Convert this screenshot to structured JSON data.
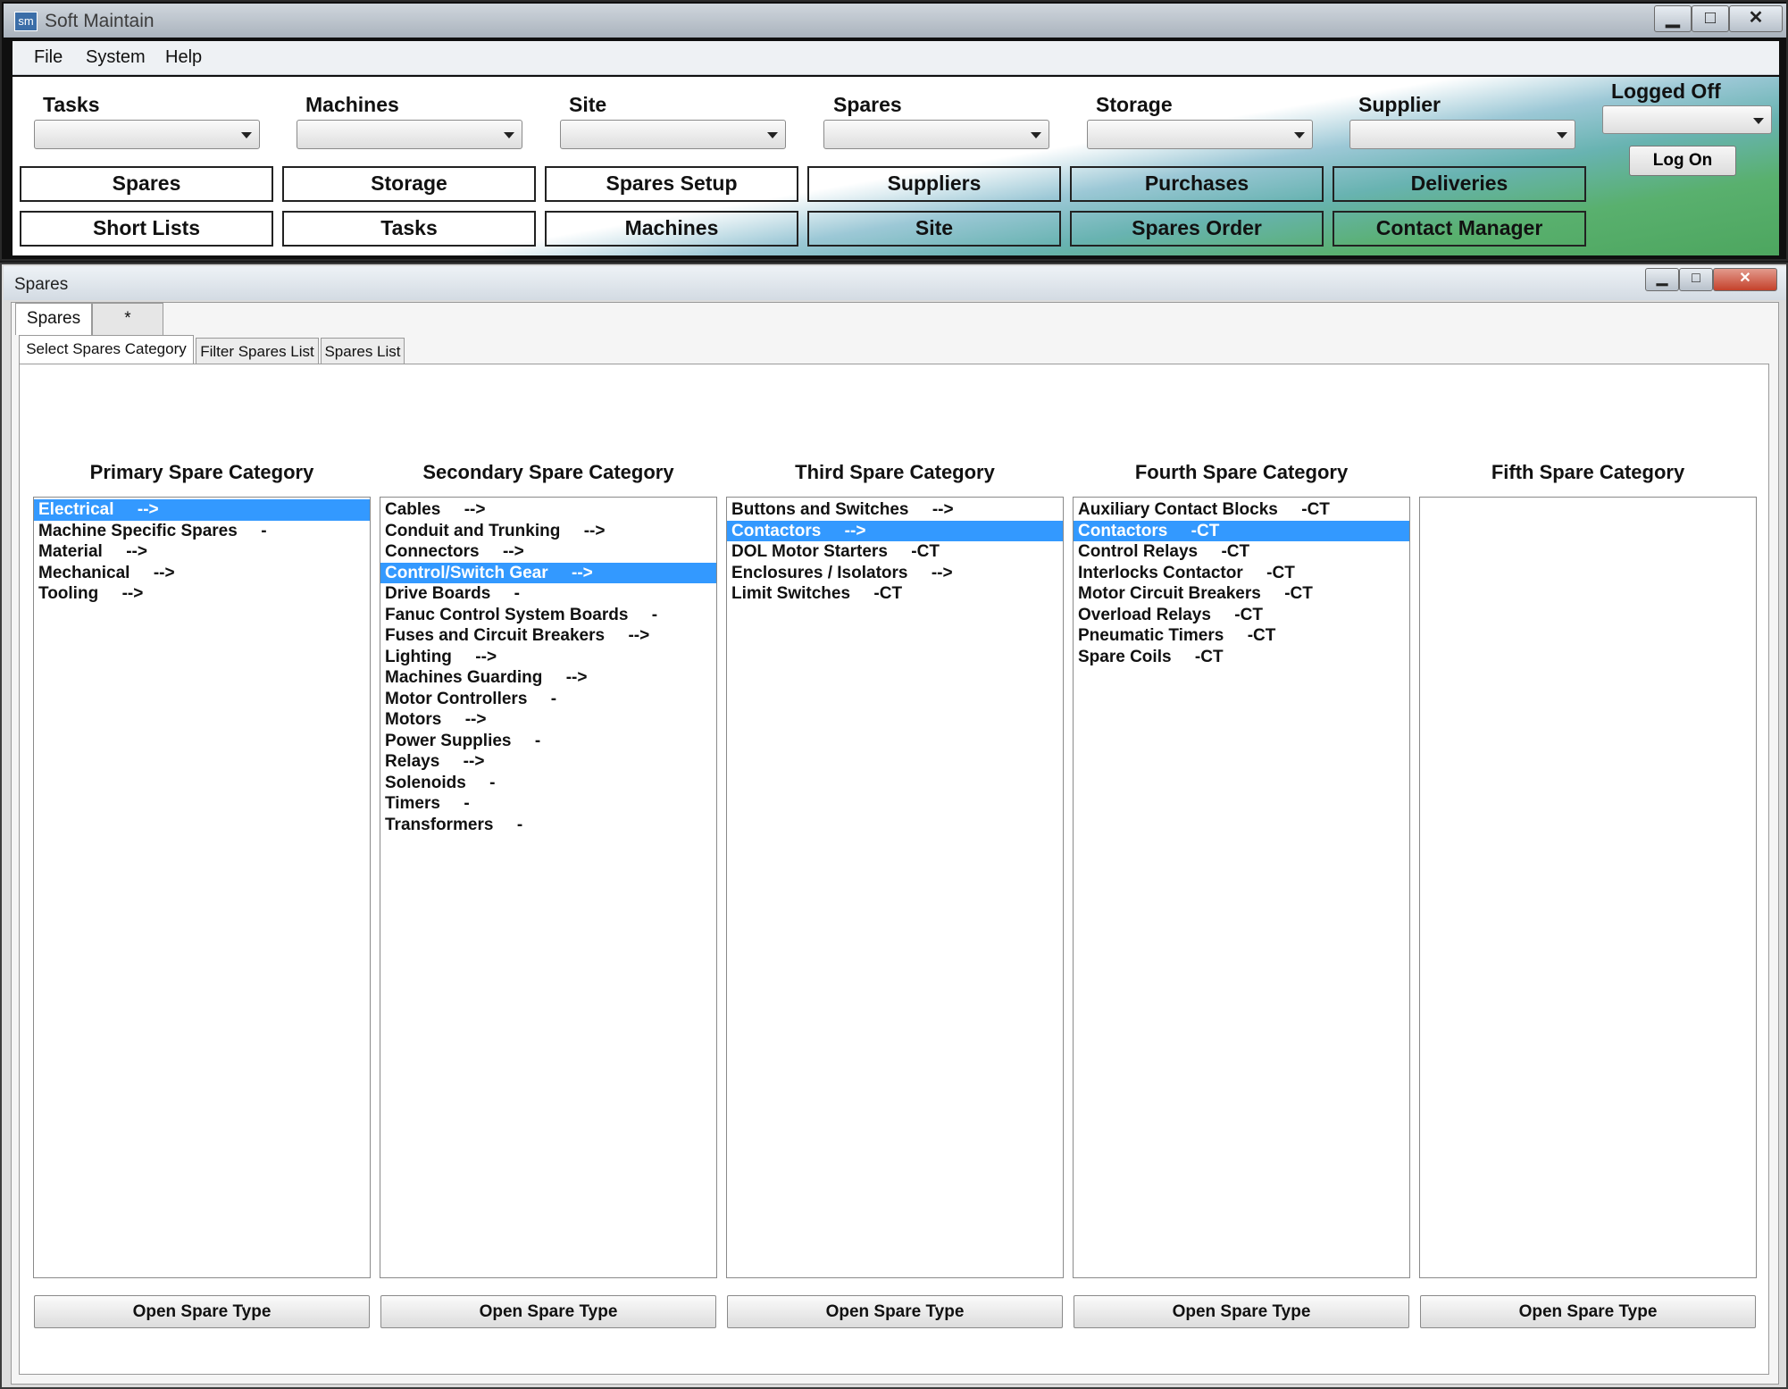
{
  "main_window": {
    "title": "Soft Maintain",
    "logo_text": "sm",
    "caption_buttons": [
      "▁",
      "□",
      "✕"
    ],
    "menu": [
      "File",
      "System",
      "Help"
    ],
    "dropdowns": [
      "Tasks",
      "Machines",
      "Site",
      "Spares",
      "Storage",
      "Supplier"
    ],
    "login_status": "Logged Off",
    "logon_button": "Log On",
    "nav_row1": [
      "Spares",
      "Storage",
      "Spares Setup",
      "Suppliers",
      "Purchases",
      "Deliveries"
    ],
    "nav_row2": [
      "Short Lists",
      "Tasks",
      "Machines",
      "Site",
      "Spares Order",
      "Contact Manager"
    ]
  },
  "child_window": {
    "title": "Spares",
    "caption_buttons": [
      "▁",
      "□",
      "✕"
    ],
    "tabs": [
      "Spares",
      "*"
    ],
    "subtabs": [
      "Select Spares Category",
      "Filter Spares List",
      "Spares List"
    ],
    "open_button": "Open Spare Type",
    "columns": [
      {
        "heading": "Primary Spare Category",
        "items": [
          "Electrical     -->",
          "Machine Specific Spares     -",
          "Material     -->",
          "Mechanical     -->",
          "Tooling     -->"
        ],
        "selected": 0
      },
      {
        "heading": "Secondary Spare Category",
        "items": [
          "Cables     -->",
          "Conduit and Trunking     -->",
          "Connectors     -->",
          "Control/Switch Gear     -->",
          "Drive Boards     -",
          "Fanuc Control System Boards     -",
          "Fuses and Circuit Breakers     -->",
          "Lighting     -->",
          "Machines Guarding     -->",
          "Motor Controllers     -",
          "Motors     -->",
          "Power Supplies     -",
          "Relays     -->",
          "Solenoids     -",
          "Timers     -",
          "Transformers     -"
        ],
        "selected": 3
      },
      {
        "heading": "Third Spare Category",
        "items": [
          "Buttons and Switches     -->",
          "Contactors     -->",
          "DOL Motor Starters     -CT",
          "Enclosures / Isolators     -->",
          "Limit Switches     -CT"
        ],
        "selected": 1
      },
      {
        "heading": "Fourth Spare Category",
        "items": [
          "Auxiliary Contact Blocks     -CT",
          "Contactors     -CT",
          "Control Relays     -CT",
          "Interlocks Contactor     -CT",
          "Motor Circuit Breakers     -CT",
          "Overload Relays     -CT",
          "Pneumatic Timers     -CT",
          "Spare Coils     -CT"
        ],
        "selected": 1
      },
      {
        "heading": "Fifth Spare Category",
        "items": [],
        "selected": -1
      }
    ]
  },
  "colors": {
    "selection": "#3399ff",
    "nav_green": "#4da65f",
    "nav_teal": "#68b3b1"
  }
}
